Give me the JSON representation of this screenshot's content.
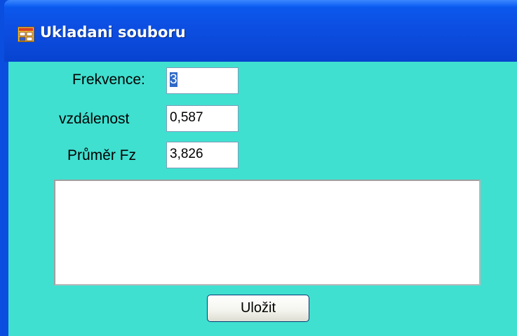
{
  "window": {
    "title": "Ukladani souboru",
    "icon": "form-window-icon"
  },
  "form": {
    "frequency": {
      "label": "Frekvence:",
      "value": "3"
    },
    "distance": {
      "label": "vzdálenost",
      "value": "0,587"
    },
    "average": {
      "label": "Průměr Fz",
      "value": "3,826"
    },
    "notes": {
      "value": ""
    },
    "save_label": "Uložit"
  },
  "colors": {
    "titlebar": "#0a4ee0",
    "client_background": "#40e0d0",
    "selection": "#316ac5"
  }
}
